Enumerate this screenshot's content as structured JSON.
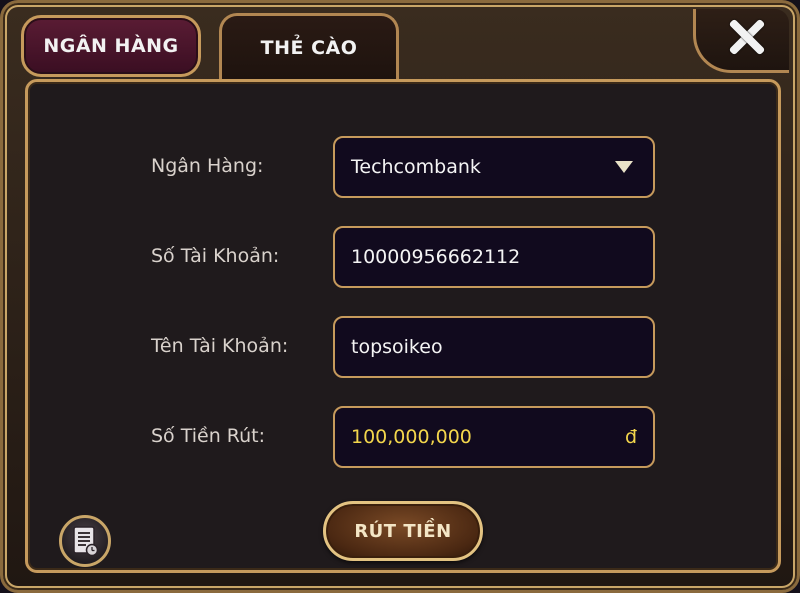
{
  "tabs": {
    "bank": "NGÂN HÀNG",
    "card": "THẺ CÀO"
  },
  "form": {
    "bank_label": "Ngân Hàng:",
    "bank_value": "Techcombank",
    "account_number_label": "Số Tài Khoản:",
    "account_number_value": "10000956662112",
    "account_name_label": "Tên Tài Khoản:",
    "account_name_value": "topsoikeo",
    "amount_label": "Số Tiền Rút:",
    "amount_value": "100,000,000",
    "currency_symbol": "đ"
  },
  "actions": {
    "withdraw_label": "RÚT TIỀN"
  },
  "icons": {
    "close": "close-icon",
    "dropdown": "chevron-down-icon",
    "history": "document-history-icon"
  },
  "colors": {
    "accent_gold": "#c69a5c",
    "active_tab": "#5a1c34",
    "amount_text": "#f3d64c",
    "field_bg": "#110a1e"
  }
}
